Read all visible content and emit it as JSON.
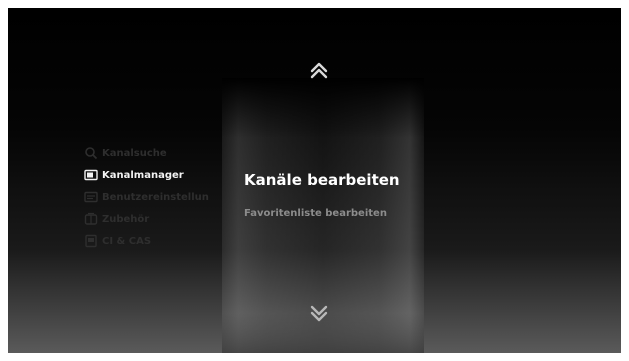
{
  "menu": {
    "items": [
      {
        "label": "Kanalsuche",
        "icon": "magnifier-icon",
        "active": false
      },
      {
        "label": "Kanalmanager",
        "icon": "tv-screen-icon",
        "active": true
      },
      {
        "label": "Benutzereinstellun",
        "icon": "settings-screen-icon",
        "active": false
      },
      {
        "label": "Zubehör",
        "icon": "accessory-icon",
        "active": false
      },
      {
        "label": "CI & CAS",
        "icon": "ci-card-icon",
        "active": false
      }
    ]
  },
  "panel": {
    "heading": "Kanäle bearbeiten",
    "subitem": "Favoritenliste bearbeiten"
  },
  "colors": {
    "active_text": "#f2f2f2",
    "inactive_text": "#2e2e2e",
    "heading": "#ffffff",
    "subitem": "#8c8c8c"
  }
}
